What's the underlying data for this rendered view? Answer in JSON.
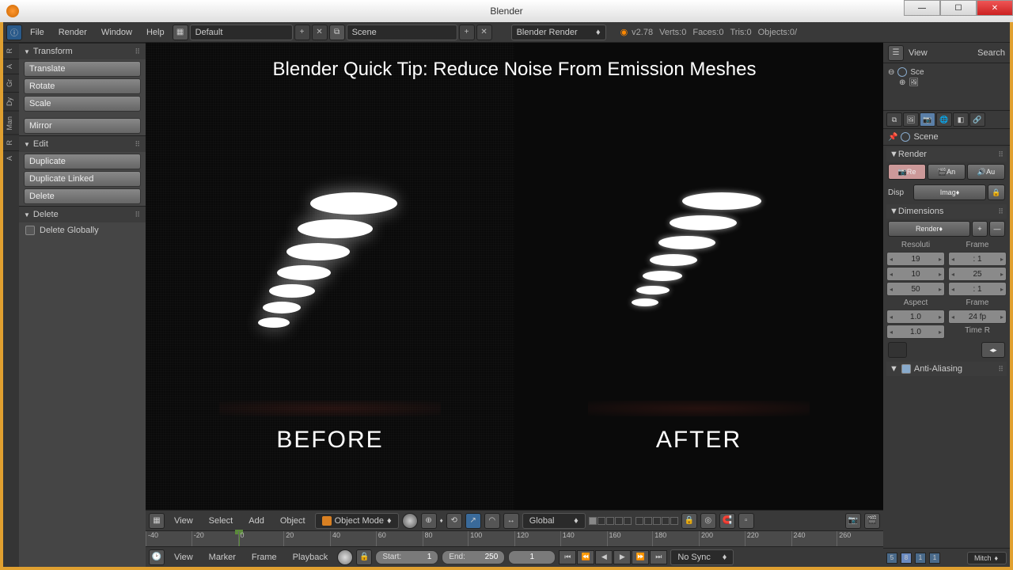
{
  "titlebar": {
    "app": "Blender"
  },
  "win": {
    "min": "—",
    "max": "☐",
    "close": "✕"
  },
  "topmenu": {
    "file": "File",
    "render": "Render",
    "window": "Window",
    "help": "Help",
    "layout_label": "Default",
    "scene_label": "Scene",
    "engine": "Blender Render",
    "version": "v2.78",
    "stats": {
      "verts": "Verts:0",
      "faces": "Faces:0",
      "tris": "Tris:0",
      "objects": "Objects:0/"
    }
  },
  "vtabs": [
    "R",
    "A",
    "Gr",
    "Dy",
    "Man",
    "R",
    "A"
  ],
  "left": {
    "transform": {
      "title": "Transform",
      "translate": "Translate",
      "rotate": "Rotate",
      "scale": "Scale",
      "mirror": "Mirror"
    },
    "edit": {
      "title": "Edit",
      "dup": "Duplicate",
      "dupl": "Duplicate Linked",
      "del": "Delete"
    },
    "delete": {
      "title": "Delete",
      "globally": "Delete Globally"
    }
  },
  "viewport": {
    "title": "Blender Quick Tip: Reduce Noise From Emission Meshes",
    "before": "BEFORE",
    "after": "AFTER"
  },
  "vhdr": {
    "view": "View",
    "select": "Select",
    "add": "Add",
    "object": "Object",
    "mode": "Object Mode",
    "orient": "Global"
  },
  "timeline": {
    "ticks": [
      "-40",
      "-20",
      "0",
      "20",
      "40",
      "60",
      "80",
      "100",
      "120",
      "140",
      "160",
      "180",
      "200",
      "220",
      "240",
      "260"
    ]
  },
  "tlhdr": {
    "view": "View",
    "marker": "Marker",
    "frame": "Frame",
    "playback": "Playback",
    "start_l": "Start:",
    "start_v": "1",
    "end_l": "End:",
    "end_v": "250",
    "cur_v": "1",
    "sync": "No Sync"
  },
  "right": {
    "view": "View",
    "search": "Search",
    "outliner_root": "Sce",
    "scene": "Scene",
    "render": {
      "title": "Render",
      "re": "Re",
      "an": "An",
      "au": "Au",
      "disp": "Disp",
      "imag": "Imag"
    },
    "dim": {
      "title": "Dimensions",
      "preset": "Render",
      "res_l": "Resoluti",
      "frame_l": "Frame",
      "res_x": "19",
      "res_y": "10",
      "res_p": "50",
      "fr_s": ": 1",
      "fr_e": "25",
      "fr_st": ": 1",
      "asp_l": "Aspect",
      "fr2_l": "Frame",
      "asp_x": "1.0",
      "asp_y": "1.0",
      "fps": "24 fp",
      "timer": "Time R"
    },
    "aa": "Anti-Aliasing",
    "frames": [
      "5",
      "8",
      "1",
      "1"
    ],
    "user": "Mitch"
  }
}
